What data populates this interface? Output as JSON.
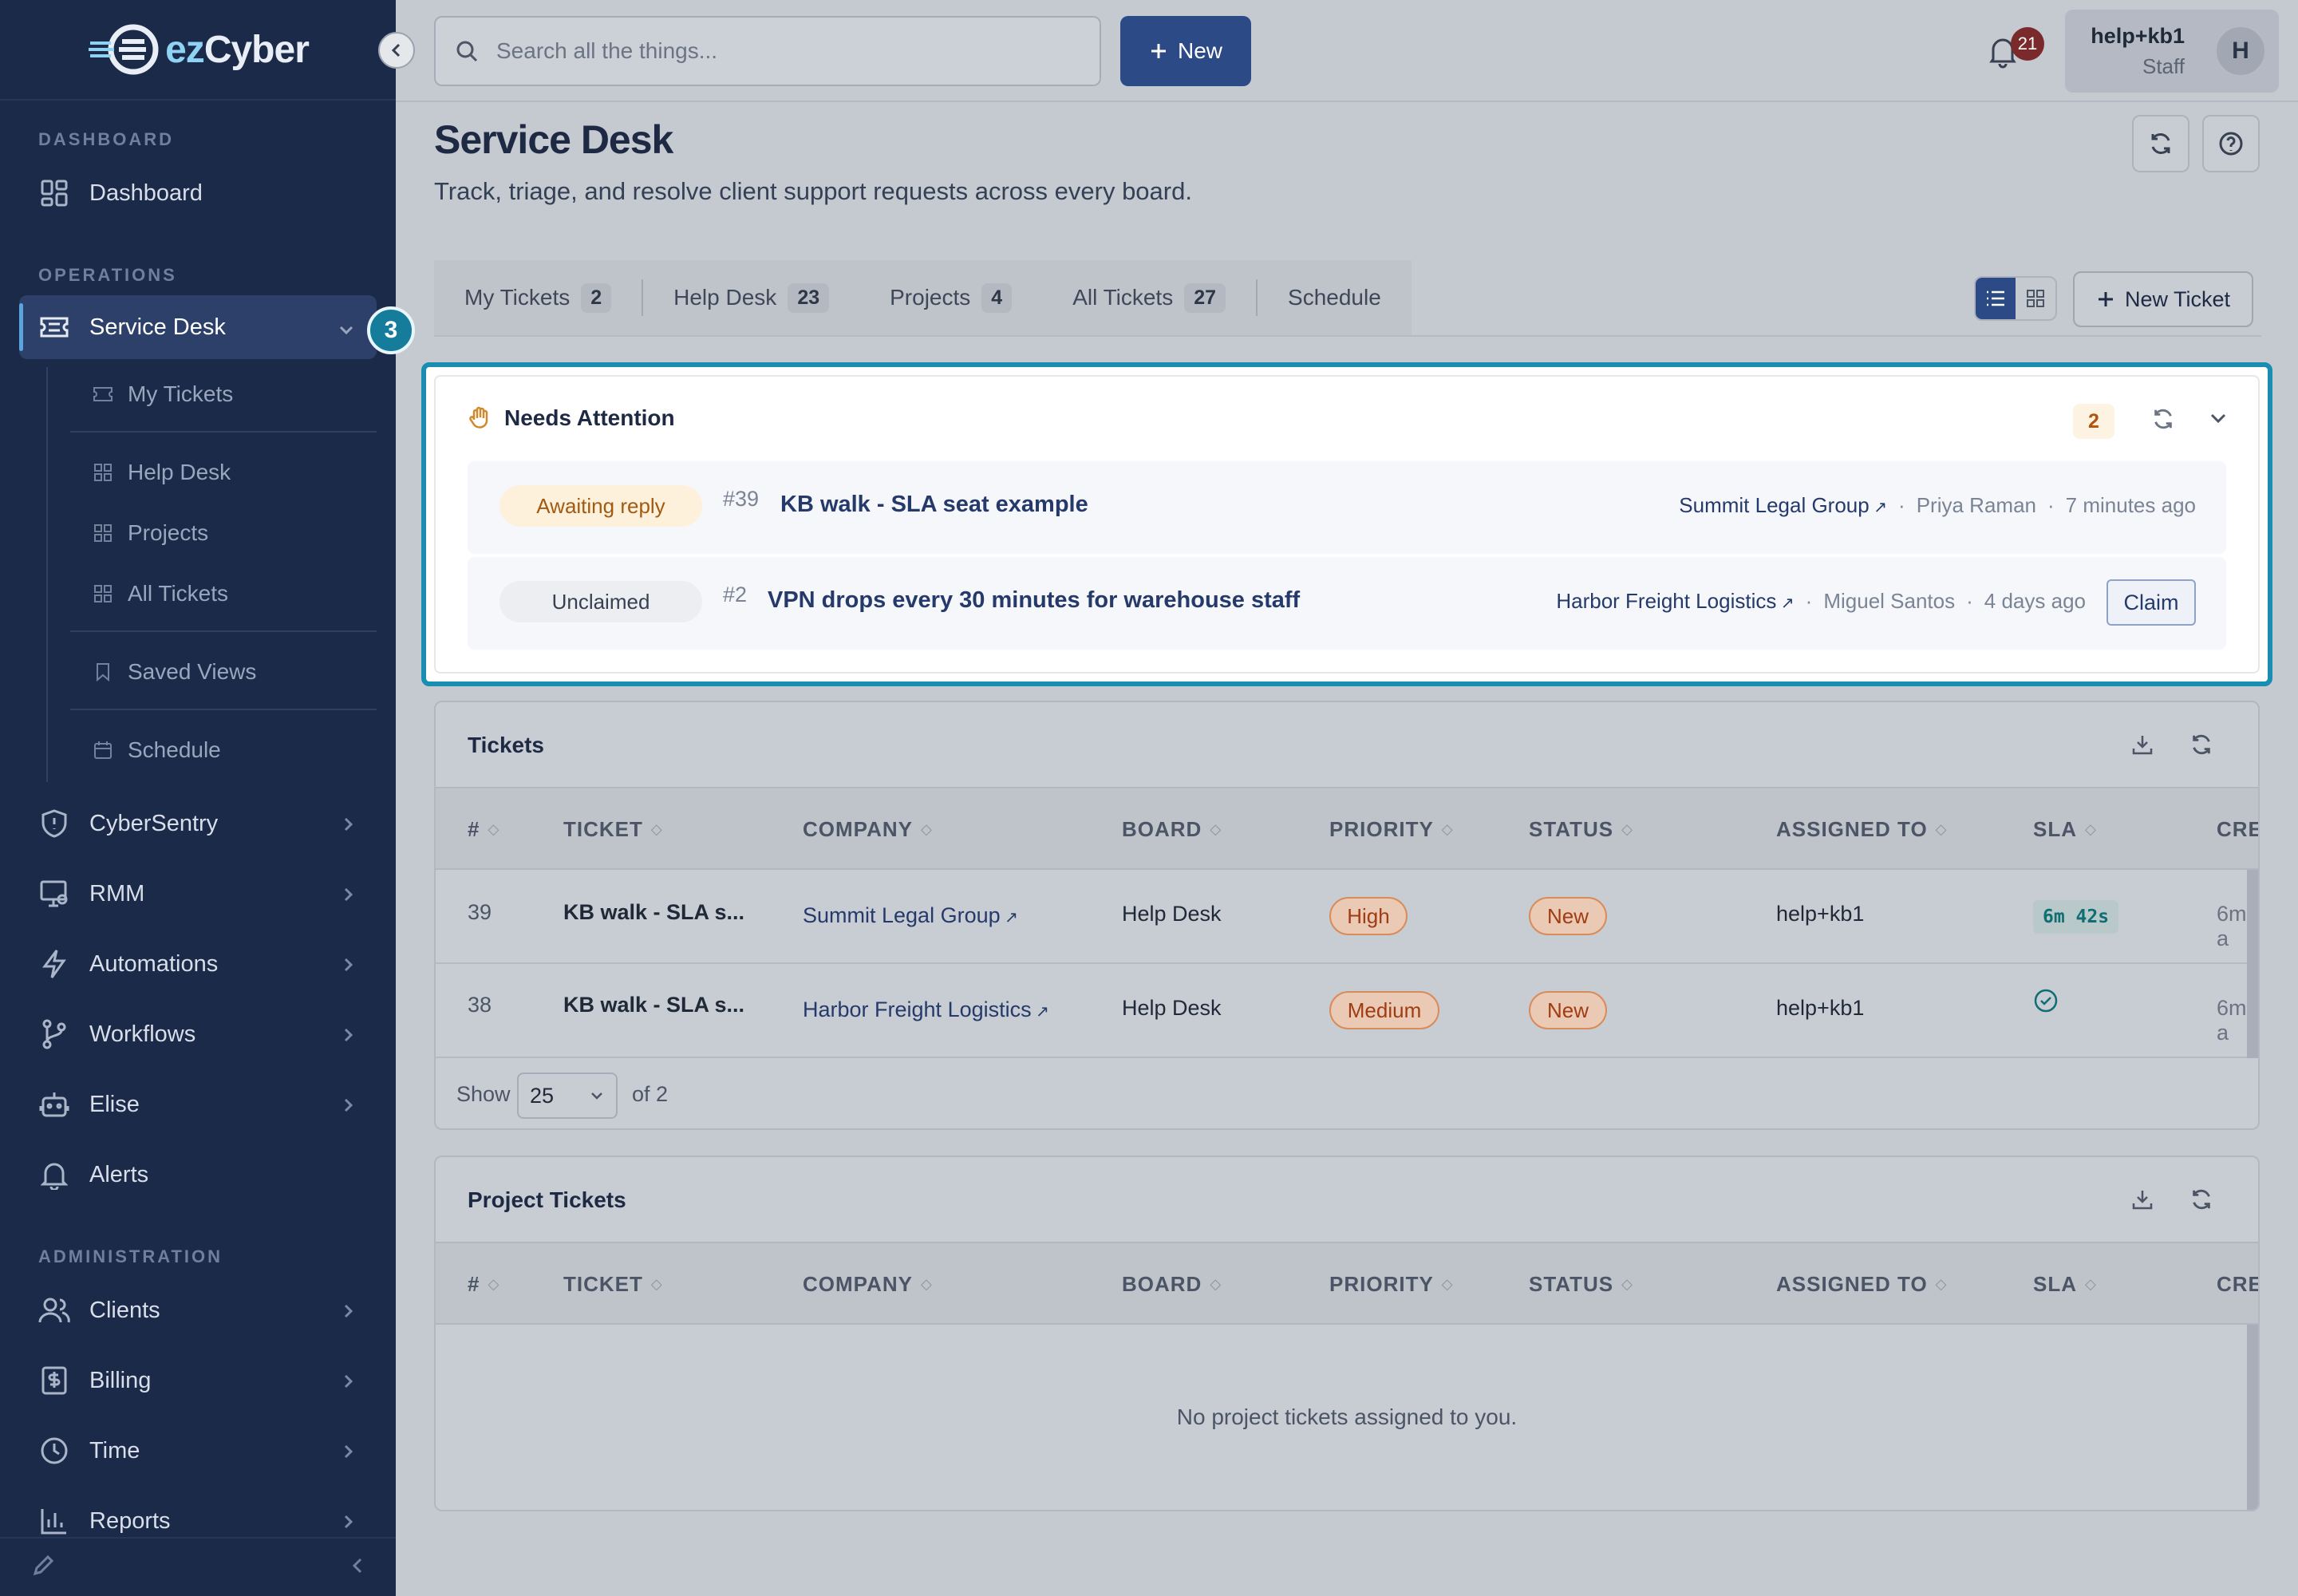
{
  "app": {
    "logo_ez": "ez",
    "logo_cyber": "Cyber"
  },
  "sidebar": {
    "sections": {
      "dashboard": "DASHBOARD",
      "operations": "OPERATIONS",
      "administration": "ADMINISTRATION"
    },
    "items": {
      "dashboard": "Dashboard",
      "service_desk": "Service Desk",
      "cybersentry": "CyberSentry",
      "rmm": "RMM",
      "automations": "Automations",
      "workflows": "Workflows",
      "elise": "Elise",
      "alerts": "Alerts",
      "clients": "Clients",
      "billing": "Billing",
      "time": "Time",
      "reports": "Reports"
    },
    "sub_items": {
      "my_tickets": "My Tickets",
      "help_desk": "Help Desk",
      "projects": "Projects",
      "all_tickets": "All Tickets",
      "saved_views": "Saved Views",
      "schedule": "Schedule"
    },
    "step_badge": "3"
  },
  "topbar": {
    "search_placeholder": "Search all the things...",
    "new_label": "New",
    "notification_count": "21",
    "user_name": "help+kb1",
    "user_role": "Staff",
    "avatar_initial": "H"
  },
  "page": {
    "title": "Service Desk",
    "subtitle": "Track, triage, and resolve client support requests across every board."
  },
  "tabs": [
    {
      "label": "My Tickets",
      "count": "2"
    },
    {
      "label": "Help Desk",
      "count": "23"
    },
    {
      "label": "Projects",
      "count": "4"
    },
    {
      "label": "All Tickets",
      "count": "27"
    },
    {
      "label": "Schedule"
    }
  ],
  "new_ticket_label": "New Ticket",
  "needs_attention": {
    "title": "Needs Attention",
    "count": "2",
    "rows": [
      {
        "status": "Awaiting reply",
        "number": "#39",
        "title": "KB walk - SLA seat example",
        "company": "Summit Legal Group",
        "person": "Priya Raman",
        "time": "7 minutes ago"
      },
      {
        "status": "Unclaimed",
        "number": "#2",
        "title": "VPN drops every 30 minutes for warehouse staff",
        "company": "Harbor Freight Logistics",
        "person": "Miguel Santos",
        "time": "4 days ago",
        "action": "Claim"
      }
    ]
  },
  "tickets": {
    "title": "Tickets",
    "columns": [
      "#",
      "TICKET",
      "COMPANY",
      "BOARD",
      "PRIORITY",
      "STATUS",
      "ASSIGNED TO",
      "SLA",
      "CRE"
    ],
    "rows": [
      {
        "id": "39",
        "ticket": "KB walk - SLA s...",
        "company": "Summit Legal Group",
        "board": "Help Desk",
        "priority": "High",
        "status": "New",
        "assigned": "help+kb1",
        "sla": "6m 42s",
        "created": "6m a"
      },
      {
        "id": "38",
        "ticket": "KB walk - SLA s...",
        "company": "Harbor Freight Logistics",
        "board": "Help Desk",
        "priority": "Medium",
        "status": "New",
        "assigned": "help+kb1",
        "sla": "",
        "created": "6m a"
      }
    ],
    "show_label": "Show",
    "page_size": "25",
    "of_label": "of 2"
  },
  "project_tickets": {
    "title": "Project Tickets",
    "columns": [
      "#",
      "TICKET",
      "COMPANY",
      "BOARD",
      "PRIORITY",
      "STATUS",
      "ASSIGNED TO",
      "SLA",
      "CRE"
    ],
    "empty": "No project tickets assigned to you."
  },
  "colors": {
    "sidebar_bg": "#1b2a48",
    "primary": "#2b4a86",
    "highlight": "#1a8db2",
    "warning": "#a13c12"
  }
}
